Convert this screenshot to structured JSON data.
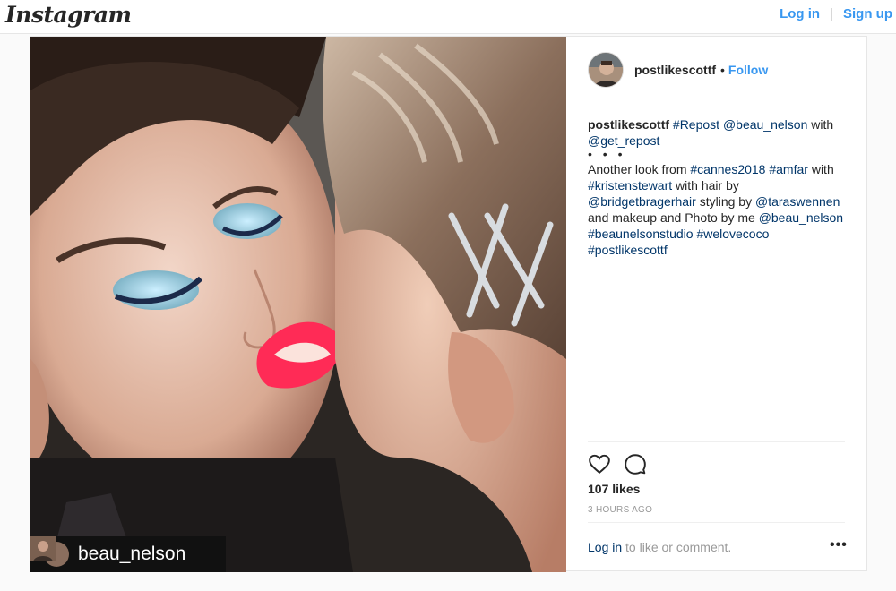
{
  "header": {
    "logo": "Instagram",
    "login_label": "Log in",
    "separator": "|",
    "signup_label": "Sign up"
  },
  "post": {
    "username": "postlikescottf",
    "follow_label": "Follow",
    "bullet": "•",
    "photo_credit": "beau_nelson",
    "caption": {
      "username": "postlikescottf",
      "line1": [
        " ",
        "#Repost",
        " ",
        "@beau_nelson",
        " with ",
        "@get_repost"
      ],
      "dots": "• • •",
      "body": [
        "Another look from ",
        "#cannes2018",
        " ",
        "#amfar",
        " with ",
        "#kristenstewart",
        " with hair by ",
        "@bridgetbragerhair",
        " styling by ",
        "@taraswennen",
        " and makeup and Photo by me ",
        "@beau_nelson",
        " ",
        "#beaunelsonstudio",
        " ",
        "#welovecoco",
        " ",
        "#postlikescottf"
      ]
    },
    "likes": "107 likes",
    "timestamp": "3 HOURS AGO",
    "comment_login": "Log in",
    "comment_suffix": " to like or comment.",
    "more": "•••"
  },
  "icons": [
    "instagram-logo",
    "heart-icon",
    "comment-icon",
    "more-icon",
    "repost-icon",
    "avatar"
  ]
}
